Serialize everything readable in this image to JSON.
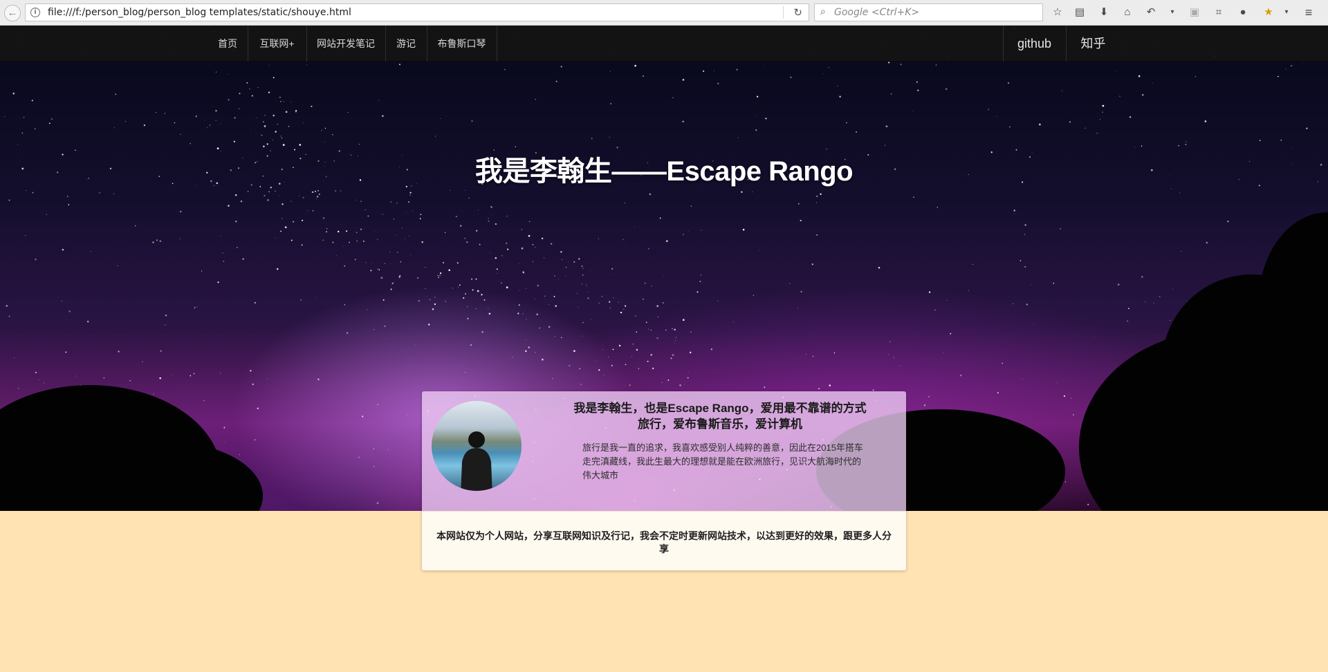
{
  "browser": {
    "back_glyph": "←",
    "url": "file:///f:/person_blog/person_blog templates/static/shouye.html",
    "search_placeholder": "Google <Ctrl+K>",
    "icons": [
      "back-icon",
      "site-info-icon",
      "reload-icon",
      "search-icon",
      "bookmark-star-icon",
      "reading-list-icon",
      "download-icon",
      "home-icon",
      "undo-icon",
      "dropdown-icon",
      "screenshot-icon",
      "crop-icon",
      "chat-icon",
      "extension-icon",
      "menu-icon"
    ]
  },
  "nav": {
    "items": [
      {
        "label": "首页"
      },
      {
        "label": "互联网+"
      },
      {
        "label": "网站开发笔记"
      },
      {
        "label": "游记"
      },
      {
        "label": "布鲁斯口琴"
      }
    ],
    "right": [
      {
        "label": "github"
      },
      {
        "label": "知乎"
      }
    ]
  },
  "hero": {
    "title": "我是李翰生——Escape Rango"
  },
  "profile": {
    "headline": "我是李翰生，也是Escape Rango，爱用最不靠谱的方式旅行，爱布鲁斯音乐，爱计算机",
    "description": "旅行是我一直的追求，我喜欢感受别人纯粹的善意，因此在2015年搭车走完滇藏线，我此生最大的理想就是能在欧洲旅行，见识大航海时代的伟大城市",
    "note": "本网站仅为个人网站，分享互联网知识及行记，我会不定时更新网站技术，以达到更好的效果，跟更多人分享"
  },
  "colors": {
    "page_bg": "#ffe3b3",
    "nav_bg": "#141414",
    "card_top": "#eecdf5",
    "card_bottom": "#fffaf0"
  }
}
